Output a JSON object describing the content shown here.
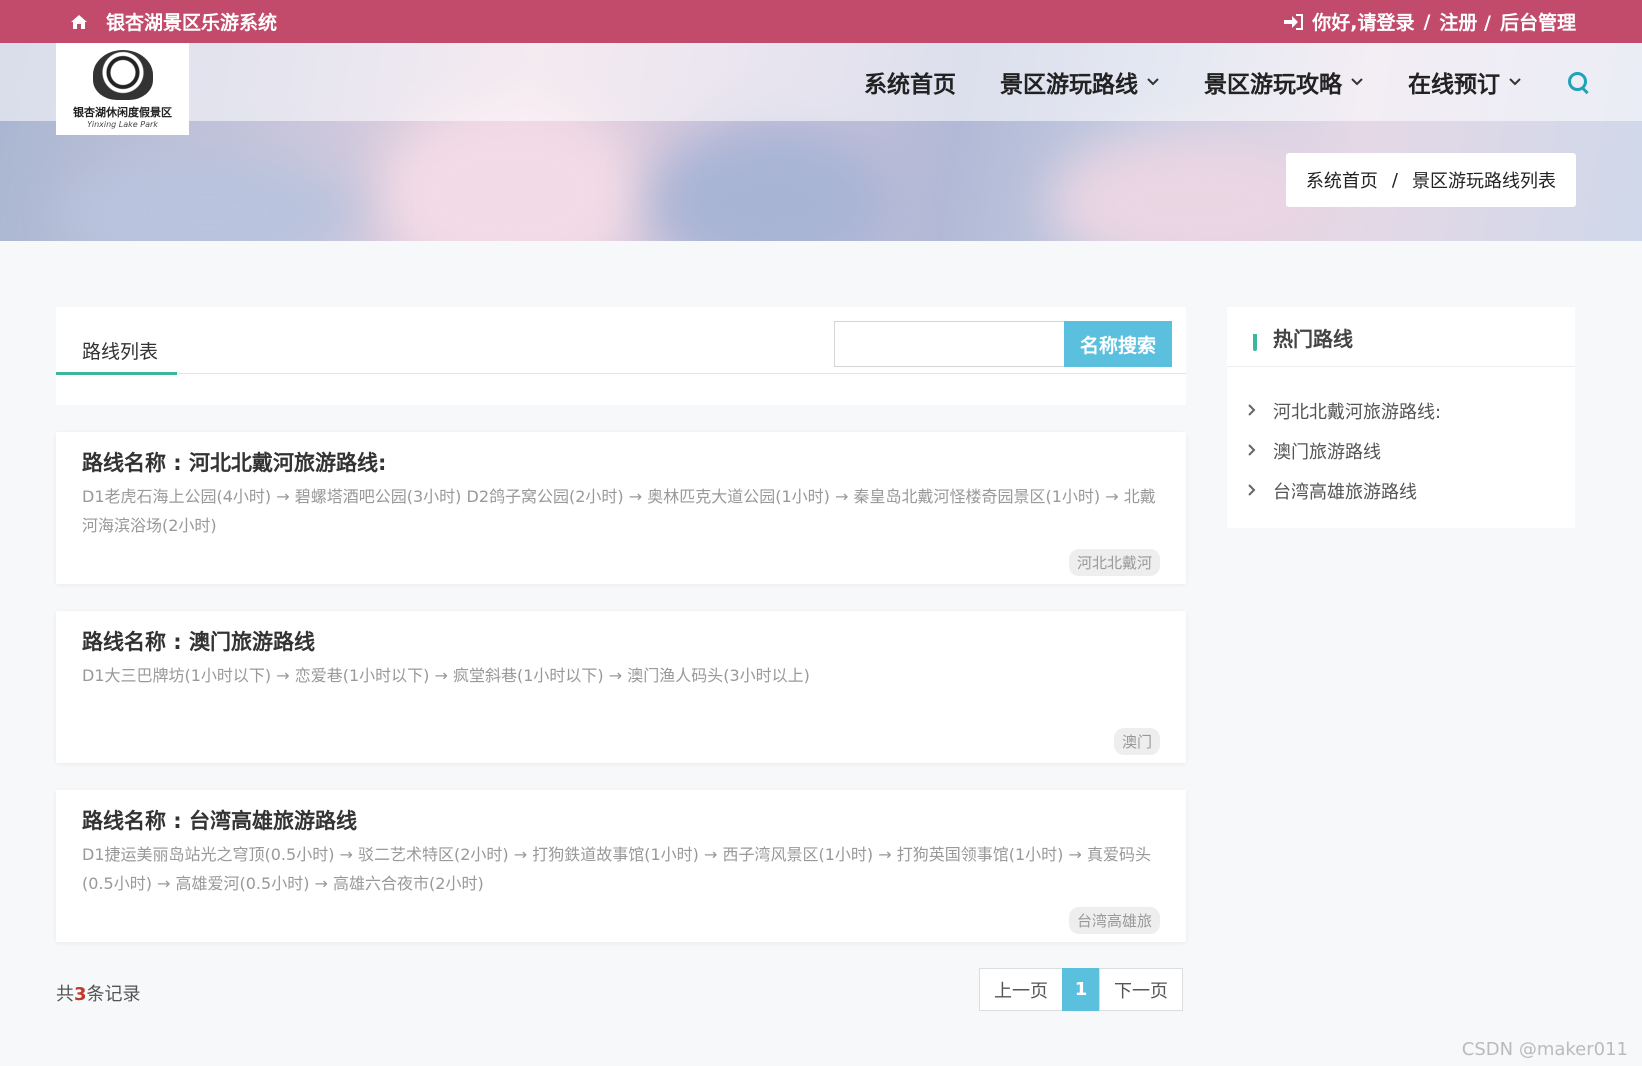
{
  "topbar": {
    "site_name": "银杏湖景区乐游系统",
    "greeting": "你好,请登录",
    "sep1": "/",
    "register": "注册 /",
    "admin": "后台管理"
  },
  "logo": {
    "text": "银杏湖休闲度假景区",
    "sub": "Yinxing Lake Park"
  },
  "nav": {
    "items": [
      {
        "label": "系统首页"
      },
      {
        "label": "景区游玩路线"
      },
      {
        "label": "景区游玩攻略"
      },
      {
        "label": "在线预订"
      }
    ],
    "chevron": "⌄"
  },
  "breadcrumb": {
    "home": "系统首页",
    "sep": "/",
    "current": "景区游玩路线列表"
  },
  "list": {
    "tab": "路线列表",
    "search_placeholder": "",
    "search_button": "名称搜索",
    "routes": [
      {
        "title": "路线名称 : 河北北戴河旅游路线:",
        "desc": "D1老虎石海上公园(4小时) → 碧螺塔酒吧公园(3小时) D2鸽子窝公园(2小时) → 奥林匹克大道公园(1小时) → 秦皇岛北戴河怪楼奇园景区(1小时) → 北戴河海滨浴场(2小时)",
        "tag": "河北北戴河"
      },
      {
        "title": "路线名称 : 澳门旅游路线",
        "desc": "D1大三巴牌坊(1小时以下) → 恋爱巷(1小时以下) → 疯堂斜巷(1小时以下) → 澳门渔人码头(3小时以上)",
        "tag": "澳门"
      },
      {
        "title": "路线名称 : 台湾高雄旅游路线",
        "desc": "D1捷运美丽岛站光之穹顶(0.5小时) → 驳二艺术特区(2小时) → 打狗鉄道故事馆(1小时) → 西子湾风景区(1小时) → 打狗英国领事馆(1小时) → 真爱码头(0.5小时) → 高雄爱河(0.5小时) → 高雄六合夜市(2小时)",
        "tag": "台湾高雄旅"
      }
    ],
    "total_prefix": "共",
    "total_count": "3",
    "total_suffix": "条记录",
    "pager": {
      "prev": "上一页",
      "current": "1",
      "next": "下一页"
    }
  },
  "sidebar": {
    "title": "热门路线",
    "items": [
      {
        "label": "河北北戴河旅游路线:"
      },
      {
        "label": "澳门旅游路线"
      },
      {
        "label": "台湾高雄旅游路线"
      }
    ]
  },
  "watermark": "CSDN @maker011",
  "colors": {
    "topbar": "#c24a6b",
    "accent": "#5bc0de",
    "tab_active": "#3bb89b"
  }
}
